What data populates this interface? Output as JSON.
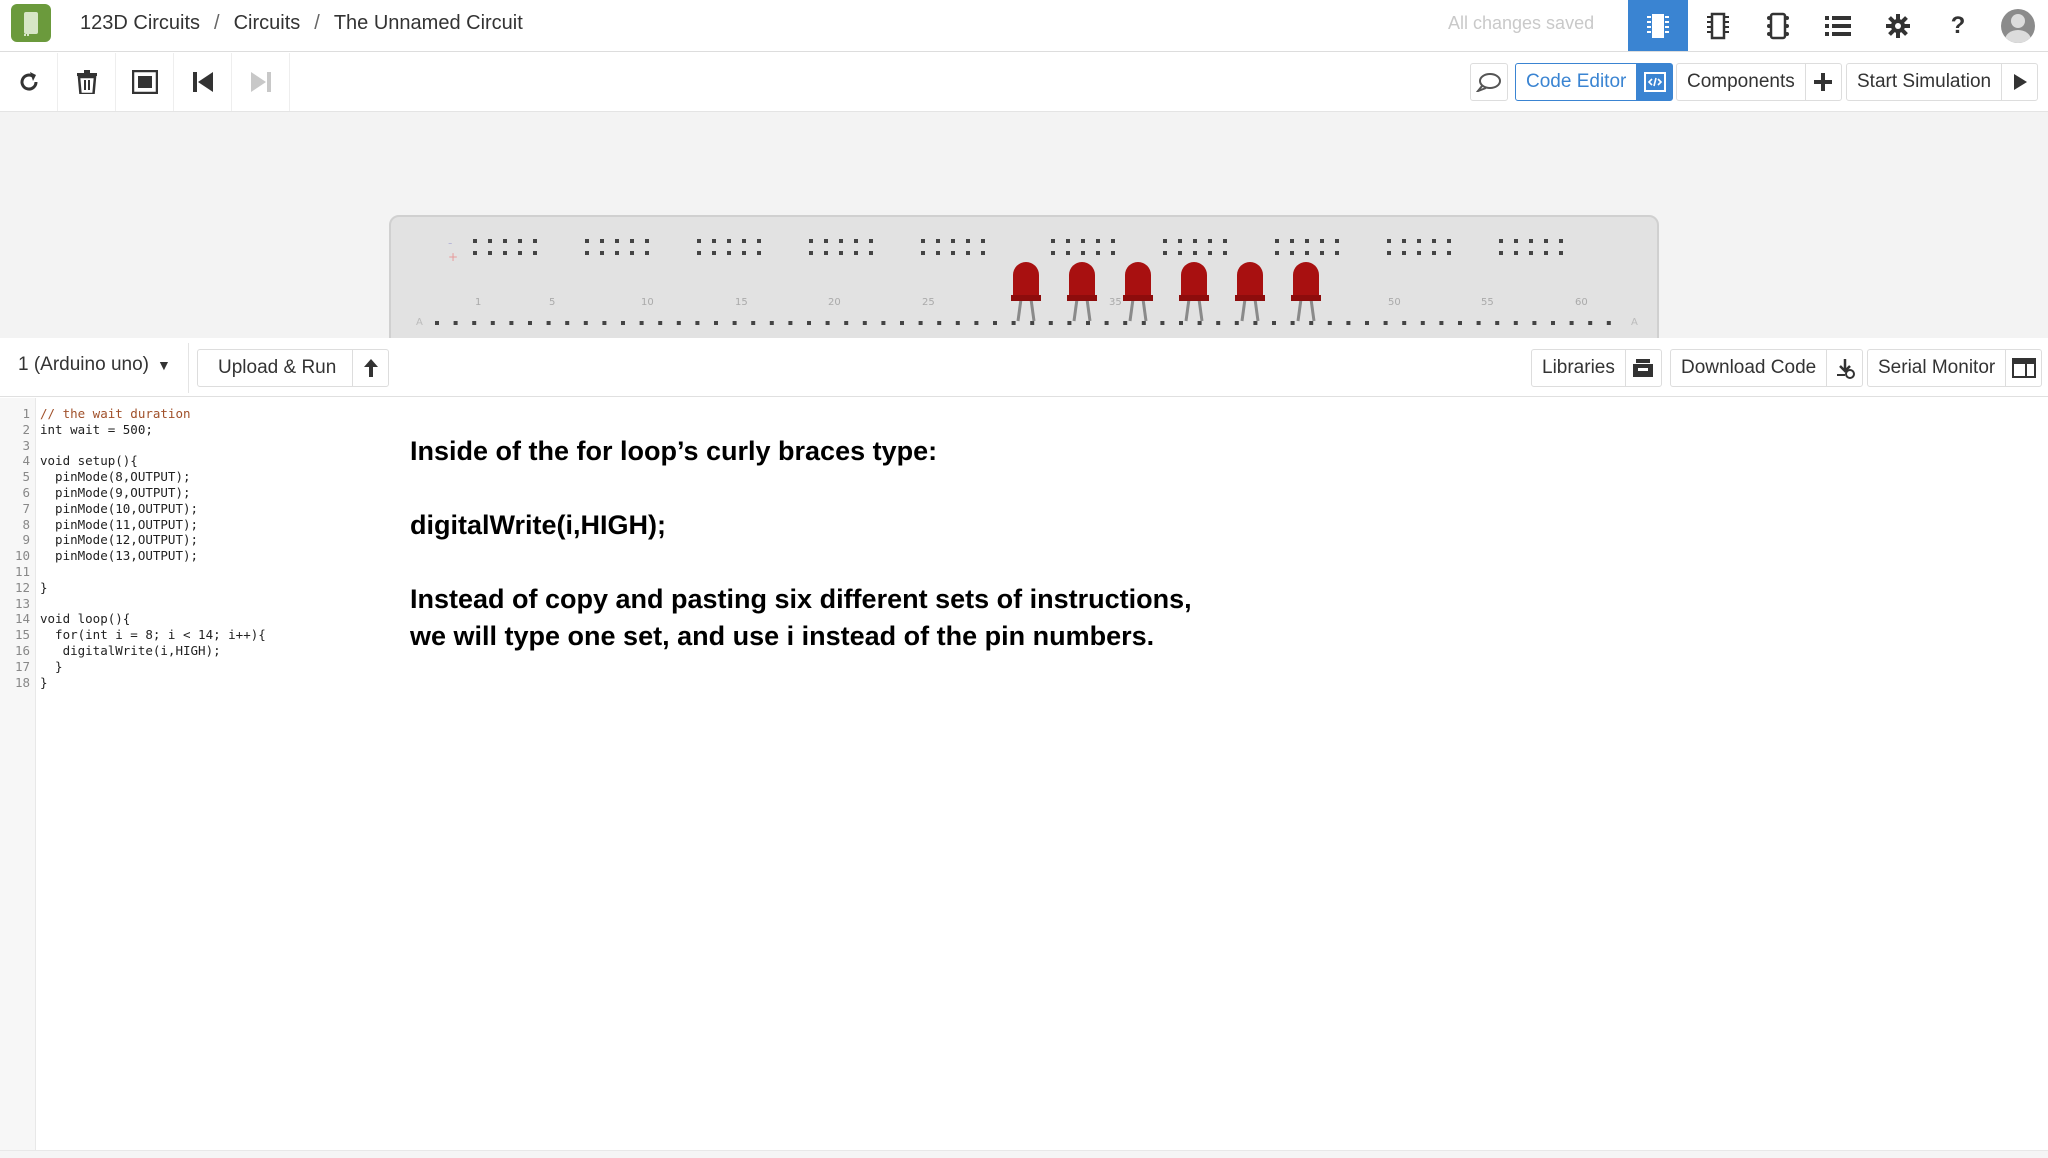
{
  "header": {
    "breadcrumb": [
      "123D Circuits",
      "Circuits",
      "The Unnamed Circuit"
    ],
    "breadcrumb_separator": "/",
    "save_status": "All changes saved",
    "icons": [
      "breadboard-view-icon",
      "schematic-view-icon",
      "pcb-view-icon",
      "list-icon",
      "gear-icon",
      "help-icon",
      "user-avatar-icon"
    ],
    "help_glyph": "?"
  },
  "toolbar": {
    "rotate_icon": "rotate-icon",
    "delete_icon": "trash-icon",
    "fit_icon": "fit-to-screen-icon",
    "undo_icon": "step-back-icon",
    "redo_icon": "step-forward-icon",
    "code_editor_label": "Code Editor",
    "components_label": "Components",
    "start_simulation_label": "Start Simulation"
  },
  "breadboard": {
    "column_labels": [
      "1",
      "5",
      "10",
      "15",
      "20",
      "25",
      "35",
      "50",
      "55",
      "60"
    ],
    "led_count": 6,
    "led_color": "#a81010"
  },
  "code_bar": {
    "board_selected": "1 (Arduino uno)",
    "upload_run_label": "Upload & Run",
    "libraries_label": "Libraries",
    "download_code_label": "Download Code",
    "serial_monitor_label": "Serial Monitor"
  },
  "editor": {
    "lines": [
      "// the wait duration",
      "int wait = 500;",
      "",
      "void setup(){",
      "  pinMode(8,OUTPUT);",
      "  pinMode(9,OUTPUT);",
      "  pinMode(10,OUTPUT);",
      "  pinMode(11,OUTPUT);",
      "  pinMode(12,OUTPUT);",
      "  pinMode(13,OUTPUT);",
      "",
      "}",
      "",
      "void loop(){",
      "  for(int i = 8; i < 14; i++){",
      "   digitalWrite(i,HIGH);",
      "  }",
      "}"
    ]
  },
  "instructions": {
    "line1": "Inside of the for loop’s curly braces type:",
    "line2": "digitalWrite(i,HIGH);",
    "line3": "Instead of copy and pasting six different sets of instructions, we will type one set, and use i instead of the pin numbers."
  },
  "colors": {
    "accent": "#3a84d2",
    "brand": "#6b9a3c"
  }
}
